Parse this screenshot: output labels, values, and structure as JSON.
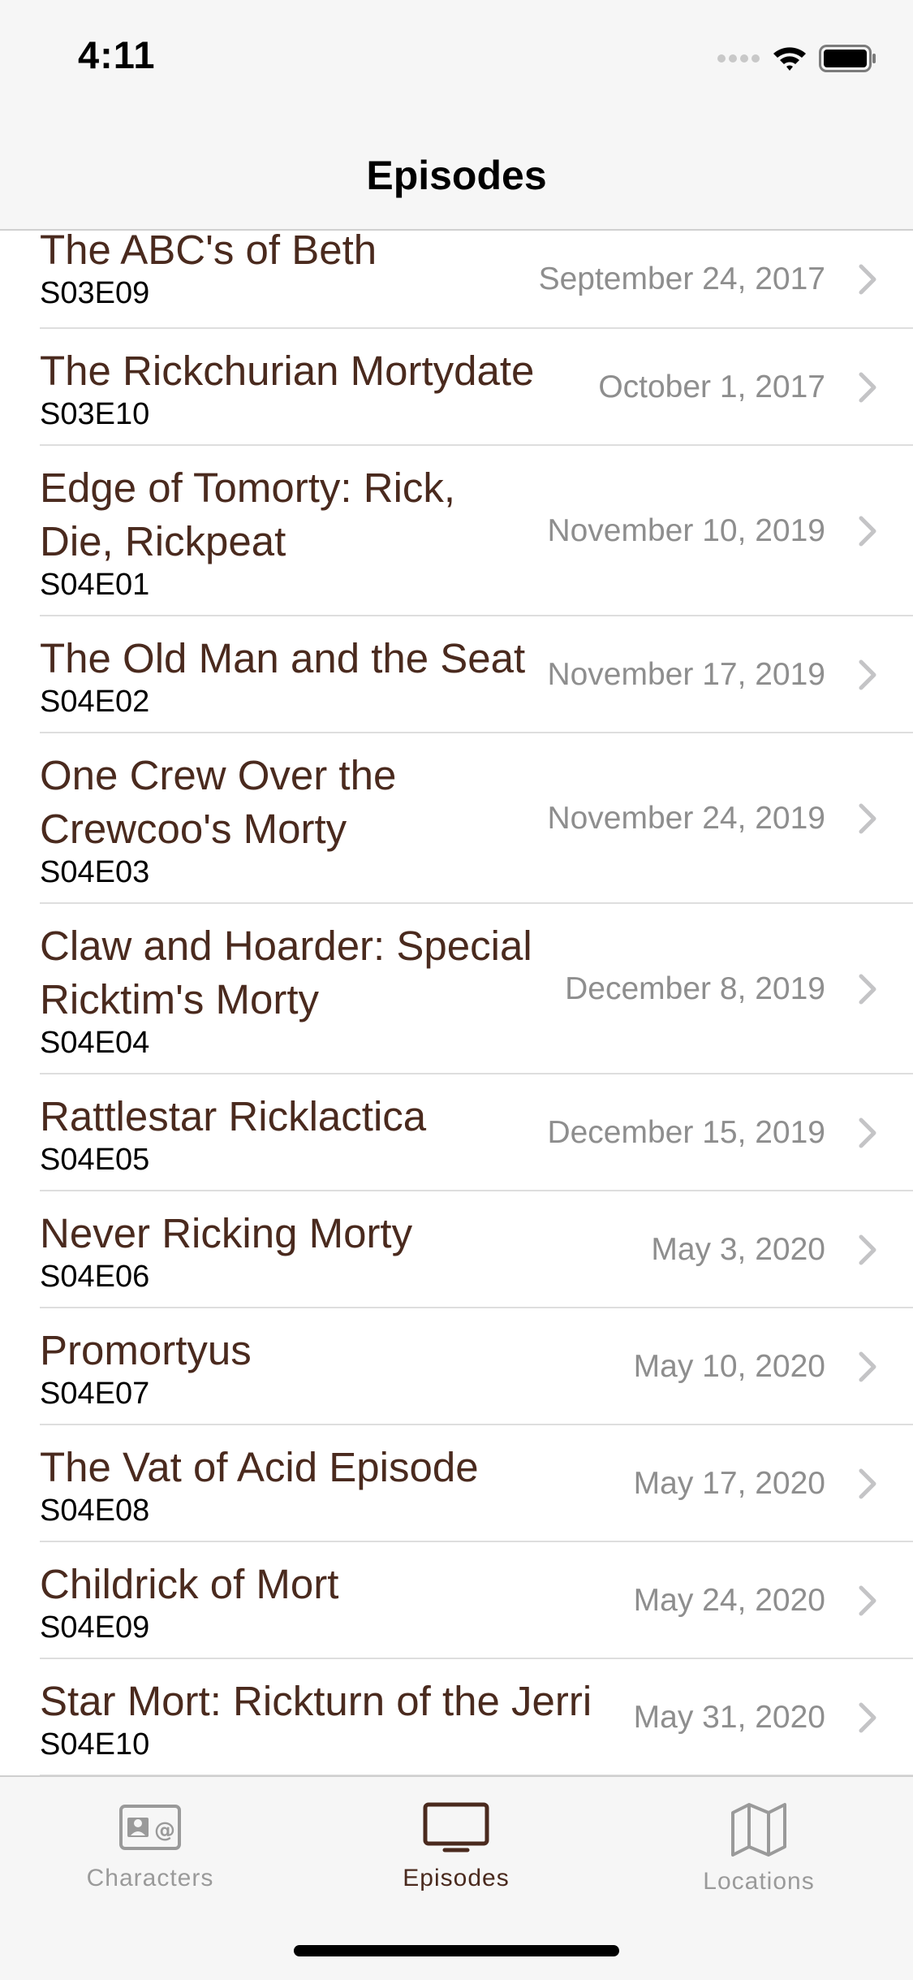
{
  "status_bar": {
    "time": "4:11"
  },
  "nav": {
    "title": "Episodes"
  },
  "episodes": [
    {
      "title": "The ABC's of Beth",
      "code": "S03E09",
      "date": "September 24, 2017"
    },
    {
      "title": "The Rickchurian Mortydate",
      "code": "S03E10",
      "date": "October 1, 2017"
    },
    {
      "title": "Edge of Tomorty: Rick, Die, Rickpeat",
      "code": "S04E01",
      "date": "November 10, 2019"
    },
    {
      "title": "The Old Man and the Seat",
      "code": "S04E02",
      "date": "November 17, 2019"
    },
    {
      "title": "One Crew Over the Crewcoo's Morty",
      "code": "S04E03",
      "date": "November 24, 2019"
    },
    {
      "title": "Claw and Hoarder: Special Ricktim's Morty",
      "code": "S04E04",
      "date": "December 8, 2019"
    },
    {
      "title": "Rattlestar Ricklactica",
      "code": "S04E05",
      "date": "December 15, 2019"
    },
    {
      "title": "Never Ricking Morty",
      "code": "S04E06",
      "date": "May 3, 2020"
    },
    {
      "title": "Promortyus",
      "code": "S04E07",
      "date": "May 10, 2020"
    },
    {
      "title": "The Vat of Acid Episode",
      "code": "S04E08",
      "date": "May 17, 2020"
    },
    {
      "title": "Childrick of Mort",
      "code": "S04E09",
      "date": "May 24, 2020"
    },
    {
      "title": "Star Mort: Rickturn of the Jerri",
      "code": "S04E10",
      "date": "May 31, 2020"
    }
  ],
  "tabs": [
    {
      "label": "Characters",
      "icon": "contact-card-icon",
      "active": false
    },
    {
      "label": "Episodes",
      "icon": "tv-icon",
      "active": true
    },
    {
      "label": "Locations",
      "icon": "map-icon",
      "active": false
    }
  ],
  "colors": {
    "accent": "#4a2a1e",
    "secondary_text": "#8e8e8e",
    "bar_background": "#f6f6f6"
  }
}
